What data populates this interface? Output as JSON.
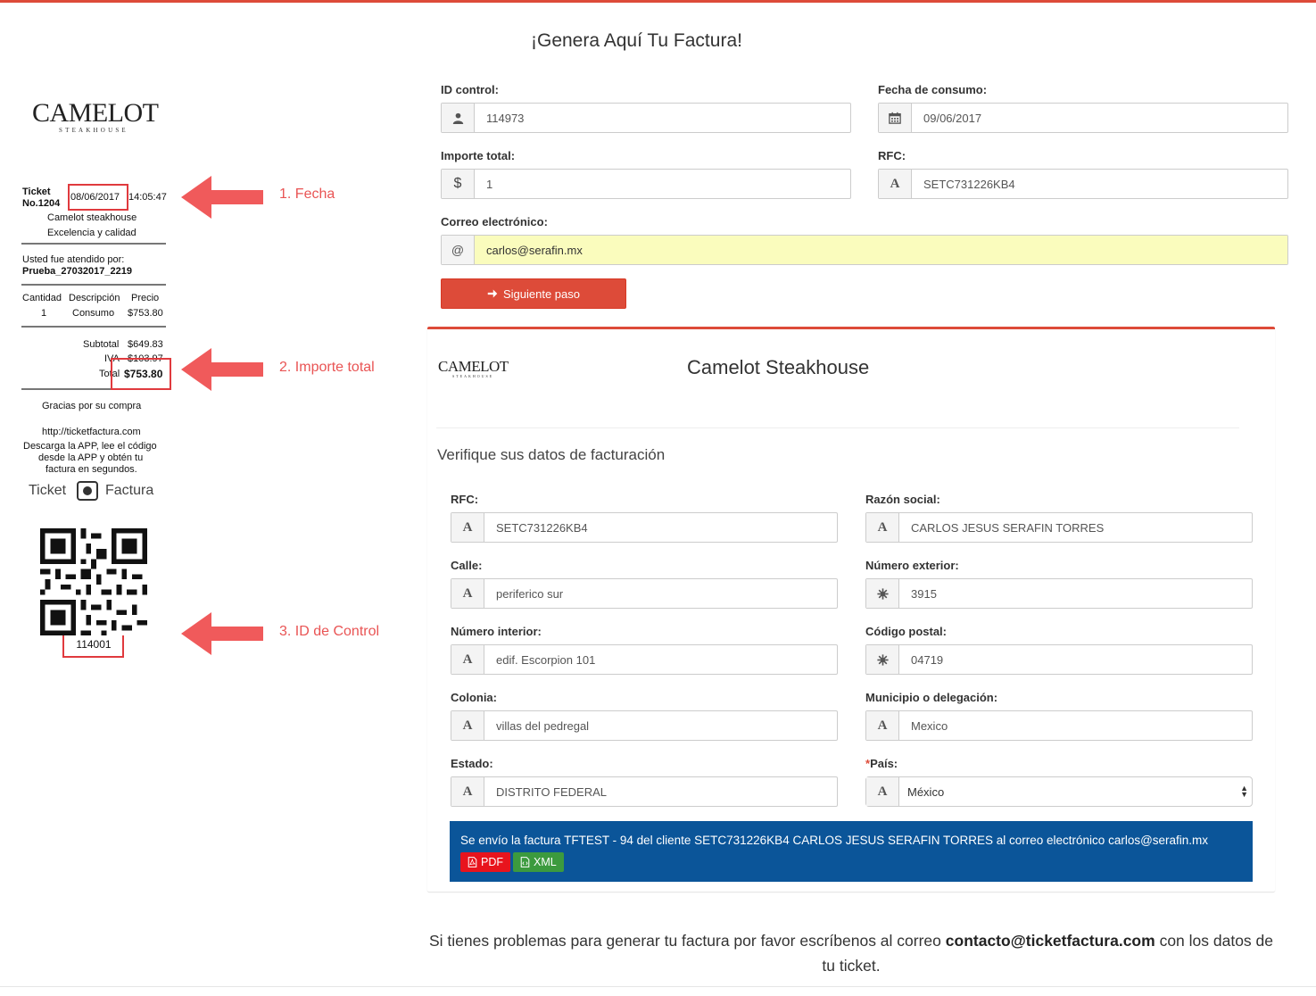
{
  "page": {
    "title": "¡Genera Aquí Tu Factura!",
    "accent_color": "#dd4b39",
    "alert_color": "#0b5599"
  },
  "ticket_example": {
    "logo_main": "CAMELOT",
    "logo_sub": "STEAKHOUSE",
    "ticket_label": "Ticket",
    "ticket_number": "No.1204",
    "date": "08/06/2017",
    "time": "14:05:47",
    "store_name": "Camelot steakhouse",
    "slogan": "Excelencia y calidad",
    "attended_label": "Usted fue atendido por:",
    "attended_by": "Prueba_27032017_2219",
    "col_qty": "Cantidad",
    "col_desc": "Descripción",
    "col_price": "Precio",
    "item_qty": "1",
    "item_desc": "Consumo",
    "item_price": "$753.80",
    "subtotal_label": "Subtotal",
    "subtotal": "$649.83",
    "iva_label": "IVA",
    "iva": "$103.97",
    "total_label": "Total",
    "total": "$753.80",
    "thanks": "Gracias por su compra",
    "url": "http://ticketfactura.com",
    "download_line1": "Descarga la APP, lee el código",
    "download_line2": "desde la APP y obtén tu",
    "download_line3": "factura en segundos.",
    "app_logo_left": "Ticket",
    "app_logo_right": "Factura",
    "control_id": "114001",
    "label_fecha": "1. Fecha",
    "label_importe": "2. Importe total",
    "label_id": "3. ID de Control"
  },
  "form": {
    "id_control_label": "ID control:",
    "id_control_value": "114973",
    "fecha_label": "Fecha de consumo:",
    "fecha_value": "09/06/2017",
    "importe_label": "Importe total:",
    "importe_value": "1",
    "importe_addon": "$",
    "rfc_label": "RFC:",
    "rfc_value": "SETC731226KB4",
    "correo_label": "Correo electrónico:",
    "correo_value": "carlos@serafin.mx",
    "correo_addon": "@",
    "next_button": "Siguiente paso"
  },
  "billing": {
    "logo_main": "CAMELOT",
    "logo_sub": "STEAKHOUSE",
    "company": "Camelot Steakhouse",
    "verify_title": "Verifique sus datos de facturación",
    "rfc_label": "RFC:",
    "rfc_value": "SETC731226KB4",
    "razon_label": "Razón social:",
    "razon_value": "CARLOS JESUS SERAFIN TORRES",
    "calle_label": "Calle:",
    "calle_value": "periferico sur",
    "num_ext_label": "Número exterior:",
    "num_ext_value": "3915",
    "num_int_label": "Número interior:",
    "num_int_value": "edif. Escorpion 101",
    "cp_label": "Código postal:",
    "cp_value": "04719",
    "colonia_label": "Colonia:",
    "colonia_value": "villas del pedregal",
    "municipio_label": "Municipio o delegación:",
    "municipio_value": "Mexico",
    "estado_label": "Estado:",
    "estado_value": "DISTRITO FEDERAL",
    "pais_required": "*",
    "pais_label": "País:",
    "pais_value": "México"
  },
  "alert": {
    "message": "Se envío la factura TFTEST - 94 del cliente SETC731226KB4 CARLOS JESUS SERAFIN TORRES al correo electrónico carlos@serafin.mx",
    "pdf_label": "PDF",
    "xml_label": "XML"
  },
  "footer": {
    "text_before": "Si tienes problemas para generar tu factura por favor escríbenos al correo",
    "email": "contacto@ticketfactura.com",
    "text_after": "con los datos de tu ticket."
  }
}
